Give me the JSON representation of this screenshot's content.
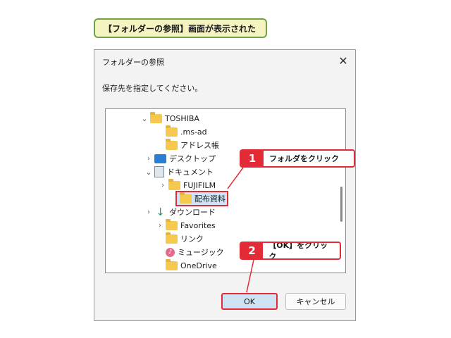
{
  "caption": "【フォルダーの参照】画面が表示された",
  "dialog": {
    "title": "フォルダーの参照",
    "instruction": "保存先を指定してください。",
    "ok_label": "OK",
    "cancel_label": "キャンセル"
  },
  "tree": [
    {
      "label": "TOSHIBA",
      "chevron": "open",
      "icon": "folder-icon"
    },
    {
      "label": ".ms-ad",
      "chevron": "none",
      "icon": "folder-icon"
    },
    {
      "label": "アドレス帳",
      "chevron": "none",
      "icon": "folder-icon"
    },
    {
      "label": "デスクトップ",
      "chevron": "closed",
      "icon": "desktop-icon"
    },
    {
      "label": "ドキュメント",
      "chevron": "open",
      "icon": "document-icon"
    },
    {
      "label": "FUJIFILM",
      "chevron": "closed",
      "icon": "folder-icon"
    },
    {
      "label": "配布資料",
      "chevron": "none",
      "icon": "folder-icon",
      "selected": true
    },
    {
      "label": "ダウンロード",
      "chevron": "closed",
      "icon": "download-icon"
    },
    {
      "label": "Favorites",
      "chevron": "closed",
      "icon": "folder-icon"
    },
    {
      "label": "リンク",
      "chevron": "none",
      "icon": "folder-icon"
    },
    {
      "label": "ミュージック",
      "chevron": "none",
      "icon": "music-icon"
    },
    {
      "label": "OneDrive",
      "chevron": "none",
      "icon": "folder-icon"
    }
  ],
  "callouts": [
    {
      "number": "1",
      "text": "フォルダをクリック"
    },
    {
      "number": "2",
      "text": "【OK】をクリック"
    }
  ],
  "colors": {
    "accent": "#e22b36",
    "caption_border": "#6ea542",
    "caption_bg": "#f5f3c2",
    "folder": "#f5c94d"
  }
}
